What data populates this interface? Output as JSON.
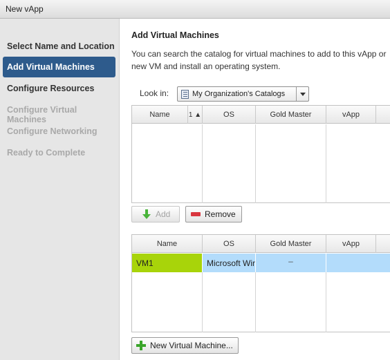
{
  "window": {
    "title": "New vApp"
  },
  "sidebar": {
    "steps": [
      {
        "label": "Select Name and Location",
        "state": "normal"
      },
      {
        "label": "Add Virtual Machines",
        "state": "active"
      },
      {
        "label": "Configure Resources",
        "state": "normal"
      },
      {
        "label": "Configure Virtual Machines",
        "state": "disabled"
      },
      {
        "label": "Configure Networking",
        "state": "disabled"
      },
      {
        "label": "Ready to Complete",
        "state": "disabled"
      }
    ]
  },
  "main": {
    "heading": "Add Virtual Machines",
    "description_line1": "You can search the catalog for virtual machines to add to this vApp or",
    "description_line2": "new VM and install an operating system.",
    "look_in_label": "Look in:",
    "look_in_value": "My Organization's Catalogs",
    "catalog_grid": {
      "columns": [
        "Name",
        "OS",
        "Gold Master",
        "vApp"
      ],
      "sort_indicator": "1 ▲",
      "rows": []
    },
    "add_button": "Add",
    "remove_button": "Remove",
    "selected_grid": {
      "columns": [
        "Name",
        "OS",
        "Gold Master",
        "vApp"
      ],
      "rows": [
        {
          "name": "VM1",
          "os": "Microsoft Wir",
          "gold_master": "–",
          "vapp": ""
        }
      ]
    },
    "new_vm_button": "New Virtual Machine..."
  },
  "colors": {
    "active_step": "#2e5b8c",
    "selected_name_cell": "#a8d40a",
    "selected_row": "#b3dcfb",
    "add_icon": "#3aa52a",
    "remove_icon": "#d9363e"
  }
}
